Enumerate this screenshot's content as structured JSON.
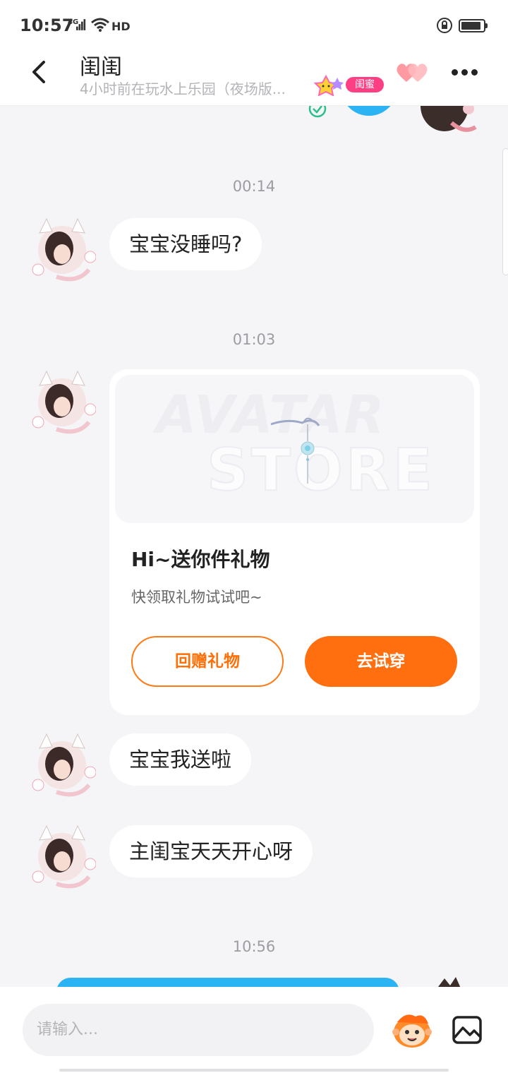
{
  "status_bar": {
    "time": "10:57",
    "network": "4G",
    "hd_label": "HD"
  },
  "header": {
    "title": "闺闺",
    "subtitle": "4小时前在玩水上乐园（夜场版...",
    "relationship_badge": "闺蜜"
  },
  "messages": {
    "ts1": "00:14",
    "msg1": "宝宝没睡吗?",
    "ts2": "01:03",
    "gift_card": {
      "title": "Hi~送你件礼物",
      "desc": "快领取礼物试试吧~",
      "return_gift_label": "回赠礼物",
      "try_on_label": "去试穿",
      "watermark_top": "AVATAR",
      "watermark_bottom": "STORE"
    },
    "msg2": "宝宝我送啦",
    "msg3": "主闺宝天天开心呀",
    "ts3": "10:56"
  },
  "input": {
    "placeholder": "请输入..."
  },
  "colors": {
    "accent_orange": "#ff6e0f",
    "bubble_blue": "#2bb3f4",
    "badge_pink": "#ff3f83"
  }
}
